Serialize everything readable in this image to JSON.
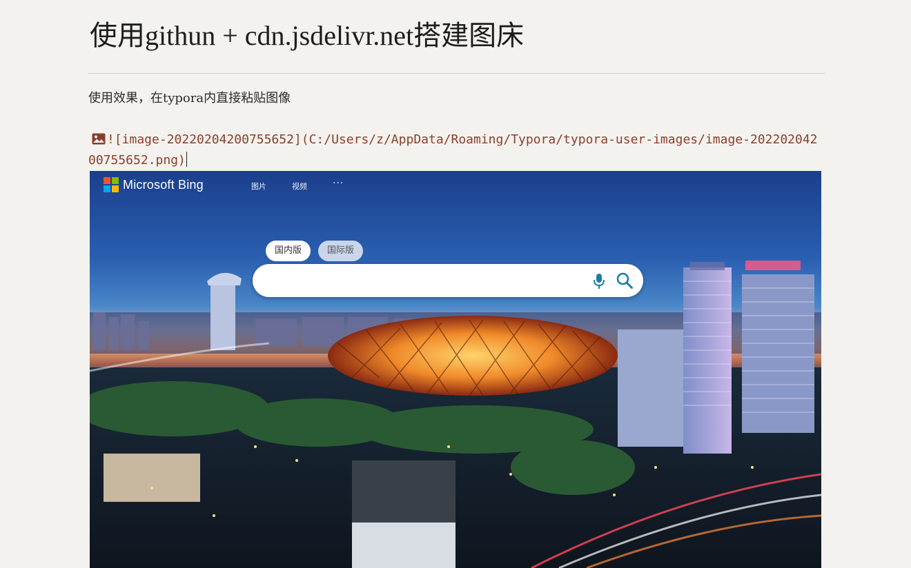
{
  "document": {
    "heading": "使用githun + cdn.jsdelivr.net搭建图床",
    "intro": "使用效果，在typora内直接粘贴图像",
    "image_markdown": "![image-20220204200755652](C:/Users/z/AppData/Roaming/Typora/typora-user-images/image-20220204200755652.png)"
  },
  "screenshot": {
    "brand": "Microsoft Bing",
    "nav": [
      "图片",
      "视频"
    ],
    "more": "···",
    "tabs": [
      "国内版",
      "国际版"
    ],
    "search_value": "",
    "icons": {
      "image": "image-icon",
      "mic": "microphone-icon",
      "search": "search-icon",
      "logo": "microsoft-logo-icon"
    },
    "colors": {
      "ms_red": "#f35325",
      "ms_green": "#81bc06",
      "ms_blue": "#05a6f0",
      "ms_yellow": "#ffba08",
      "bing_teal": "#1a7fa5",
      "link_code": "#8b3f2a"
    }
  }
}
